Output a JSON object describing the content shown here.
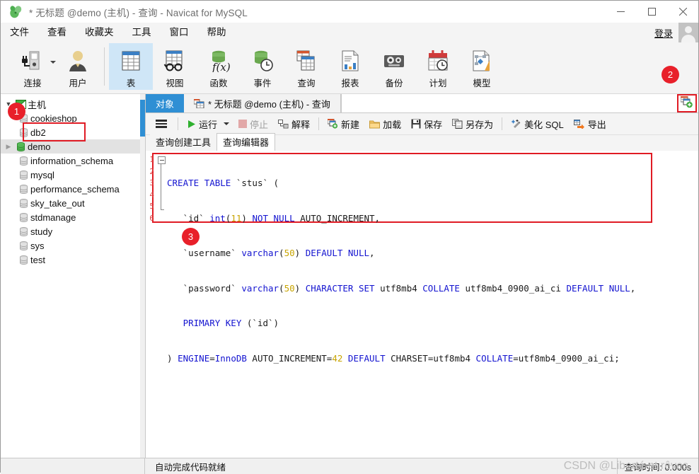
{
  "window": {
    "title": "* 无标题 @demo (主机) - 查询 - Navicat for MySQL",
    "minimize": "—",
    "maximize": "☐",
    "close": "✕"
  },
  "menubar": {
    "items": [
      {
        "label": "文件",
        "name": "menu-file"
      },
      {
        "label": "查看",
        "name": "menu-view"
      },
      {
        "label": "收藏夹",
        "name": "menu-favorites"
      },
      {
        "label": "工具",
        "name": "menu-tools"
      },
      {
        "label": "窗口",
        "name": "menu-window"
      },
      {
        "label": "帮助",
        "name": "menu-help"
      }
    ],
    "login_label": "登录"
  },
  "toolbar": {
    "items": [
      {
        "label": "连接",
        "icon": "connection-icon",
        "selected": false
      },
      {
        "label": "用户",
        "icon": "user-icon",
        "selected": false
      },
      {
        "label": "表",
        "icon": "table-icon",
        "selected": true
      },
      {
        "label": "视图",
        "icon": "view-icon",
        "selected": false
      },
      {
        "label": "函数",
        "icon": "function-icon",
        "selected": false
      },
      {
        "label": "事件",
        "icon": "event-icon",
        "selected": false
      },
      {
        "label": "查询",
        "icon": "query-icon",
        "selected": false
      },
      {
        "label": "报表",
        "icon": "report-icon",
        "selected": false
      },
      {
        "label": "备份",
        "icon": "backup-icon",
        "selected": false
      },
      {
        "label": "计划",
        "icon": "schedule-icon",
        "selected": false
      },
      {
        "label": "模型",
        "icon": "model-icon",
        "selected": false
      }
    ]
  },
  "sidebar": {
    "root": {
      "label": "主机",
      "icon": "host-icon"
    },
    "items": [
      {
        "label": "cookieshop",
        "active": false
      },
      {
        "label": "db2",
        "active": false
      },
      {
        "label": "demo",
        "active": true
      },
      {
        "label": "information_schema",
        "active": false
      },
      {
        "label": "mysql",
        "active": false
      },
      {
        "label": "performance_schema",
        "active": false
      },
      {
        "label": "sky_take_out",
        "active": false
      },
      {
        "label": "stdmanage",
        "active": false
      },
      {
        "label": "study",
        "active": false
      },
      {
        "label": "sys",
        "active": false
      },
      {
        "label": "test",
        "active": false
      }
    ]
  },
  "tabs": {
    "object_tab": "对象",
    "query_tab": "* 无标题 @demo (主机) - 查询",
    "new_query_icon": "new-query-icon"
  },
  "query_toolbar": {
    "menu_icon": "hamburger-menu-icon",
    "buttons": [
      {
        "label": "运行",
        "icon": "run-icon",
        "disabled": false
      },
      {
        "label": "停止",
        "icon": "stop-icon",
        "disabled": true
      },
      {
        "label": "解释",
        "icon": "explain-icon",
        "disabled": false
      },
      {
        "label": "新建",
        "icon": "new-icon",
        "disabled": false
      },
      {
        "label": "加载",
        "icon": "load-icon",
        "disabled": false
      },
      {
        "label": "保存",
        "icon": "save-icon",
        "disabled": false
      },
      {
        "label": "另存为",
        "icon": "save-as-icon",
        "disabled": false
      },
      {
        "label": "美化 SQL",
        "icon": "beautify-icon",
        "disabled": false
      },
      {
        "label": "导出",
        "icon": "export-icon",
        "disabled": false
      }
    ]
  },
  "subtabs": [
    {
      "label": "查询创建工具",
      "active": false
    },
    {
      "label": "查询编辑器",
      "active": true
    }
  ],
  "editor": {
    "line_numbers": [
      "1",
      "2",
      "3",
      "4",
      "5",
      "6"
    ],
    "lines": [
      "CREATE TABLE `stus` (",
      "  `id` int(11) NOT NULL AUTO_INCREMENT,",
      "  `username` varchar(50) DEFAULT NULL,",
      "  `password` varchar(50) CHARACTER SET utf8mb4 COLLATE utf8mb4_0900_ai_ci DEFAULT NULL,",
      "  PRIMARY KEY (`id`)",
      ") ENGINE=InnoDB AUTO_INCREMENT=42 DEFAULT CHARSET=utf8mb4 COLLATE=utf8mb4_0900_ai_ci;"
    ]
  },
  "annotations": [
    {
      "number": "1",
      "name": "badge-1"
    },
    {
      "number": "2",
      "name": "badge-2"
    },
    {
      "number": "3",
      "name": "badge-3"
    }
  ],
  "statusbar": {
    "message": "自动完成代码就绪",
    "query_time": "查询时间: 0.000s",
    "watermark": "CSDN @Liberté et rêves"
  },
  "colors": {
    "accent_blue": "#2f8fd4",
    "selected_tool": "#cfe6f7",
    "annotation_red": "#e8202a",
    "keyword_blue": "#1414d0",
    "number_yellow": "#c8a400"
  }
}
